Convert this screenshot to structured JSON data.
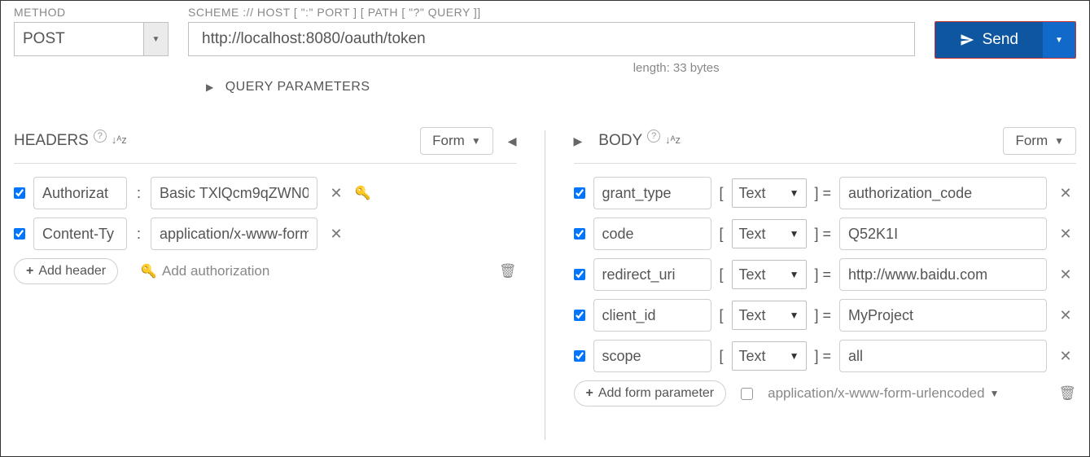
{
  "top": {
    "method_label": "METHOD",
    "url_label": "SCHEME :// HOST [ \":\" PORT ] [ PATH [ \"?\" QUERY ]]",
    "method_value": "POST",
    "url_value": "http://localhost:8080/oauth/token",
    "send_label": "Send",
    "length_text": "length: 33 bytes",
    "query_params_label": "QUERY PARAMETERS"
  },
  "headers_panel": {
    "title": "HEADERS",
    "form_label": "Form",
    "rows": [
      {
        "name": "Authorizat",
        "value": "Basic TXlQcm9qZWN0"
      },
      {
        "name": "Content-Ty",
        "value": "application/x-www-form"
      }
    ],
    "add_header_label": "Add header",
    "add_auth_label": "Add authorization"
  },
  "body_panel": {
    "title": "BODY",
    "form_label": "Form",
    "type_option": "Text",
    "rows": [
      {
        "name": "grant_type",
        "value": "authorization_code"
      },
      {
        "name": "code",
        "value": "Q52K1I"
      },
      {
        "name": "redirect_uri",
        "value": "http://www.baidu.com"
      },
      {
        "name": "client_id",
        "value": "MyProject"
      },
      {
        "name": "scope",
        "value": "all"
      }
    ],
    "add_param_label": "Add form parameter",
    "content_type_label": "application/x-www-form-urlencoded"
  }
}
